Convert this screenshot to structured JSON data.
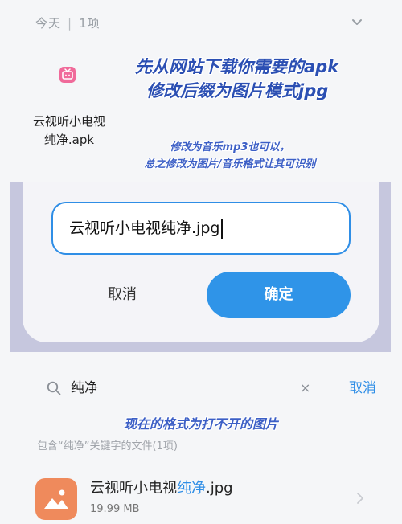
{
  "header": {
    "date_label": "今天",
    "separator": "|",
    "count_label": "1项"
  },
  "file_preview": {
    "name_line1": "云视听小电视",
    "name_line2": "纯净.apk",
    "icon": "tv-app-icon"
  },
  "annotations": {
    "line1": "先从网站下载你需要的apk",
    "line2": "修改后缀为图片模式jpg",
    "line3": "修改为音乐mp3也可以，",
    "line4": "总之修改为图片/音乐格式让其可识别",
    "line5": "现在的格式为打不开的图片"
  },
  "rename_dialog": {
    "input_value": "云视听小电视纯净.jpg",
    "cancel_label": "取消",
    "confirm_label": "确定"
  },
  "search": {
    "query": "纯净",
    "clear_symbol": "×",
    "cancel_label": "取消"
  },
  "results": {
    "caption": "包含“纯净”关键字的文件(1项)",
    "item": {
      "name_prefix": "云视听小电视",
      "name_highlight": "纯净",
      "name_suffix": ".jpg",
      "size": "19.99 MB"
    }
  },
  "colors": {
    "accent": "#2f8ee6",
    "annotation": "#2b4fb3",
    "dim_overlay": "#c6c7de",
    "image_icon": "#ef8a5c"
  }
}
